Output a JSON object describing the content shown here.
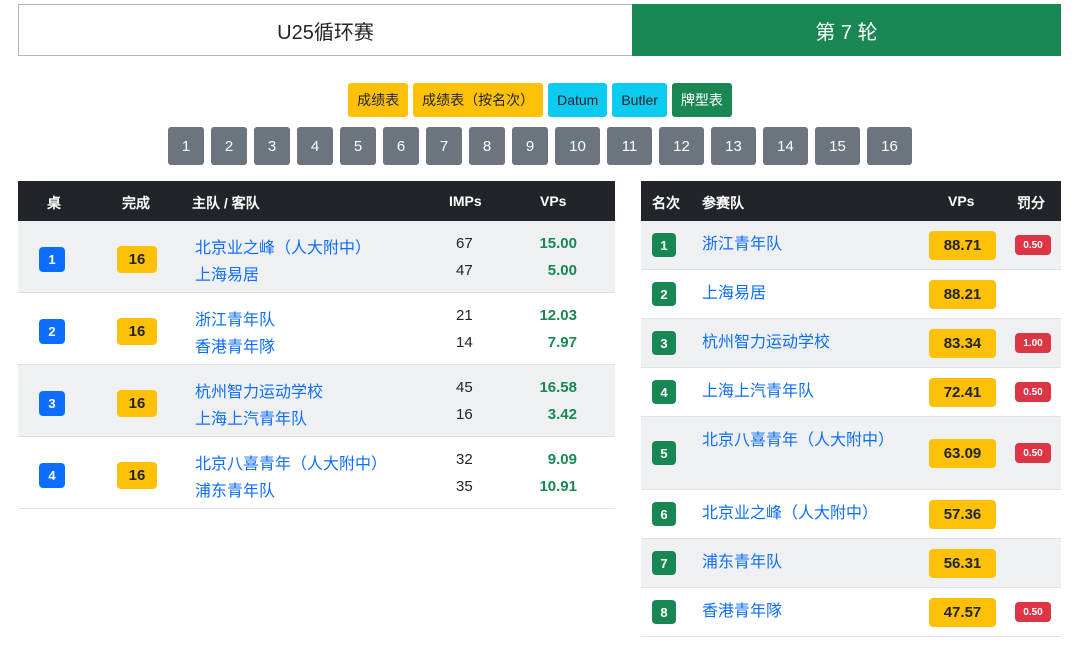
{
  "header": {
    "event": "U25循环赛",
    "round": "第 7 轮"
  },
  "report_buttons": [
    {
      "label": "成绩表",
      "color": "#ffc107"
    },
    {
      "label": "成绩表（按名次）",
      "color": "#ffc107"
    },
    {
      "label": "Datum",
      "color": "#0dcaf0"
    },
    {
      "label": "Butler",
      "color": "#0dcaf0"
    },
    {
      "label": "牌型表",
      "color": "#198754"
    }
  ],
  "board_buttons": [
    "1",
    "2",
    "3",
    "4",
    "5",
    "6",
    "7",
    "8",
    "9",
    "10",
    "11",
    "12",
    "13",
    "14",
    "15",
    "16"
  ],
  "matches": {
    "headers": {
      "table": "桌",
      "done": "完成",
      "teams": "主队 / 客队",
      "imps": "IMPs",
      "vps": "VPs"
    },
    "rows": [
      {
        "table": "1",
        "done": "16",
        "home": "北京业之峰（人大附中）",
        "away": "上海易居",
        "home_imps": "67",
        "away_imps": "47",
        "home_vps": "15.00",
        "away_vps": "5.00"
      },
      {
        "table": "2",
        "done": "16",
        "home": "浙江青年队",
        "away": "香港青年隊",
        "home_imps": "21",
        "away_imps": "14",
        "home_vps": "12.03",
        "away_vps": "7.97"
      },
      {
        "table": "3",
        "done": "16",
        "home": "杭州智力运动学校",
        "away": "上海上汽青年队",
        "home_imps": "45",
        "away_imps": "16",
        "home_vps": "16.58",
        "away_vps": "3.42"
      },
      {
        "table": "4",
        "done": "16",
        "home": "北京八喜青年（人大附中）",
        "away": "浦东青年队",
        "home_imps": "32",
        "away_imps": "35",
        "home_vps": "9.09",
        "away_vps": "10.91"
      }
    ]
  },
  "standings": {
    "headers": {
      "rank": "名次",
      "team": "参赛队",
      "vps": "VPs",
      "penalty": "罚分"
    },
    "rows": [
      {
        "rank": "1",
        "team": "浙江青年队",
        "vps": "88.71",
        "penalty": "0.50"
      },
      {
        "rank": "2",
        "team": "上海易居",
        "vps": "88.21",
        "penalty": ""
      },
      {
        "rank": "3",
        "team": "杭州智力运动学校",
        "vps": "83.34",
        "penalty": "1.00"
      },
      {
        "rank": "4",
        "team": "上海上汽青年队",
        "vps": "72.41",
        "penalty": "0.50"
      },
      {
        "rank": "5",
        "team": "北京八喜青年（人大附中）",
        "vps": "63.09",
        "penalty": "0.50"
      },
      {
        "rank": "6",
        "team": "北京业之峰（人大附中）",
        "vps": "57.36",
        "penalty": ""
      },
      {
        "rank": "7",
        "team": "浦东青年队",
        "vps": "56.31",
        "penalty": ""
      },
      {
        "rank": "8",
        "team": "香港青年隊",
        "vps": "47.57",
        "penalty": "0.50"
      }
    ]
  }
}
